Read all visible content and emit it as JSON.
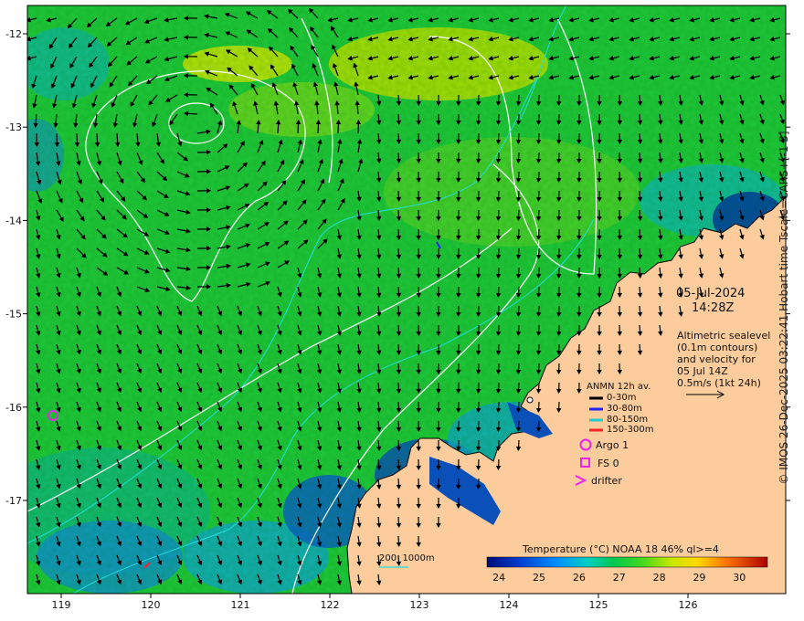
{
  "map": {
    "date": "05-Jul-2024",
    "time": "14:28Z",
    "description": [
      "Altimetric sealevel",
      "(0.1m contours)",
      "and velocity for",
      "05 Jul 14Z",
      "0.5m/s (1kt 24h)"
    ],
    "copyright": "© IMOS 26-Dec-2025 03:22:41 Hobart time Tscale=CARS+[-1 3]",
    "lon_ticks": [
      "119",
      "120",
      "121",
      "122",
      "123",
      "124",
      "125",
      "126"
    ],
    "lat_ticks": [
      "-12",
      "-13",
      "-14",
      "-15",
      "-16",
      "-17"
    ],
    "colorbar": {
      "title": "Temperature (°C) NOAA 18 46% ql>=4",
      "ticks": [
        "24",
        "25",
        "26",
        "27",
        "28",
        "29",
        "30"
      ],
      "range": [
        23.7,
        30.7
      ]
    },
    "bathymetry_label": "200  1000m",
    "anmn": {
      "title": "ANMN 12h av.",
      "rows": [
        {
          "label": "0-30m",
          "color": "#000000"
        },
        {
          "label": "30-80m",
          "color": "#2222ff"
        },
        {
          "label": "80-150m",
          "color": "#22cccc"
        },
        {
          "label": "150-300m",
          "color": "#ff2222"
        }
      ]
    },
    "markers": [
      {
        "label": "Argo 1",
        "icon": "circle-icon"
      },
      {
        "label": "FS 0",
        "icon": "square-icon"
      },
      {
        "label": "drifter",
        "icon": "chevron-icon"
      }
    ],
    "colors": {
      "land": "#fccc9c",
      "argo": "#ee22ee",
      "contour": "#ffffff",
      "isobath": "#22dddd"
    }
  }
}
